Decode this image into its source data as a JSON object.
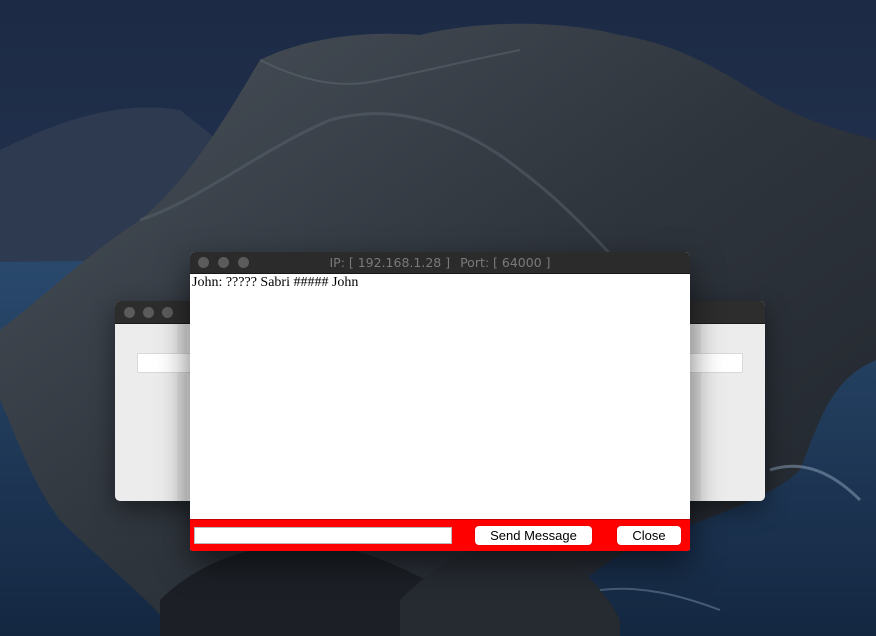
{
  "desktop": {
    "wallpaper": "catalina-island",
    "colors": {
      "sky": "#1e2d49",
      "sea": "#1c3452",
      "rock": "#3b4148"
    }
  },
  "back_window": {
    "controls": [
      "close-icon",
      "minimize-icon",
      "zoom-icon"
    ],
    "colors": {
      "titlebar": "#2d2d2d",
      "body": "#ececec"
    }
  },
  "chat_window": {
    "title": "IP: [ 192.168.1.28 ]   Port: [ 64000 ]",
    "title_ip": "IP: [ 192.168.1.28 ]",
    "title_port": "Port: [ 64000 ]",
    "controls": [
      "close-icon",
      "minimize-icon",
      "zoom-icon"
    ],
    "messages": [
      {
        "text": "John: ????? Sabri ##### John"
      }
    ],
    "input": {
      "value": "",
      "placeholder": ""
    },
    "buttons": {
      "send_label": "Send Message",
      "close_label": "Close"
    },
    "colors": {
      "titlebar": "#2b2b2b",
      "bottom_bar": "#ff0000",
      "chat_bg": "#ffffff"
    }
  }
}
